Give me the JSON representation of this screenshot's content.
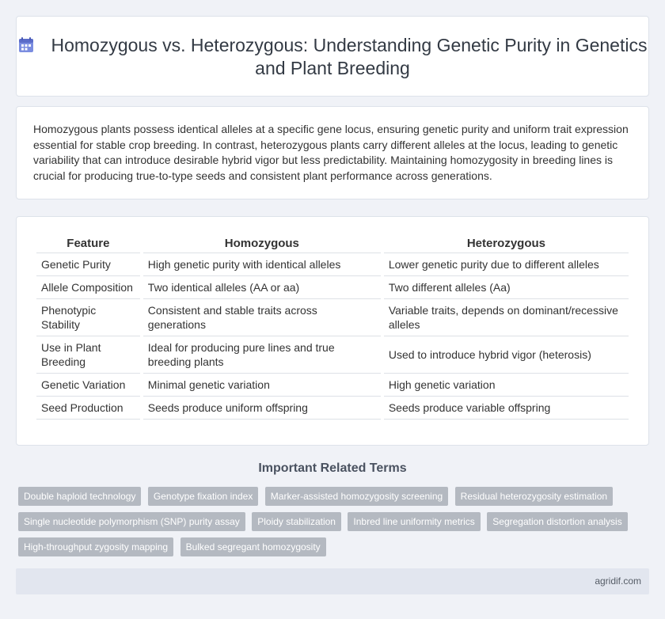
{
  "header": {
    "title": "Homozygous vs. Heterozygous: Understanding Genetic Purity in Genetics and Plant Breeding",
    "icon": "calendar-icon"
  },
  "intro": {
    "text": "Homozygous plants possess identical alleles at a specific gene locus, ensuring genetic purity and uniform trait expression essential for stable crop breeding. In contrast, heterozygous plants carry different alleles at the locus, leading to genetic variability that can introduce desirable hybrid vigor but less predictability. Maintaining homozygosity in breeding lines is crucial for producing true-to-type seeds and consistent plant performance across generations."
  },
  "table": {
    "headers": [
      "Feature",
      "Homozygous",
      "Heterozygous"
    ],
    "rows": [
      [
        "Genetic Purity",
        "High genetic purity with identical alleles",
        "Lower genetic purity due to different alleles"
      ],
      [
        "Allele Composition",
        "Two identical alleles (AA or aa)",
        "Two different alleles (Aa)"
      ],
      [
        "Phenotypic Stability",
        "Consistent and stable traits across generations",
        "Variable traits, depends on dominant/recessive alleles"
      ],
      [
        "Use in Plant Breeding",
        "Ideal for producing pure lines and true breeding plants",
        "Used to introduce hybrid vigor (heterosis)"
      ],
      [
        "Genetic Variation",
        "Minimal genetic variation",
        "High genetic variation"
      ],
      [
        "Seed Production",
        "Seeds produce uniform offspring",
        "Seeds produce variable offspring"
      ]
    ]
  },
  "related": {
    "title": "Important Related Terms",
    "tags": [
      "Double haploid technology",
      "Genotype fixation index",
      "Marker-assisted homozygosity screening",
      "Residual heterozygosity estimation",
      "Single nucleotide polymorphism (SNP) purity assay",
      "Ploidy stabilization",
      "Inbred line uniformity metrics",
      "Segregation distortion analysis",
      "High-throughput zygosity mapping",
      "Bulked segregant homozygosity"
    ]
  },
  "footer": {
    "site": "agridif.com"
  }
}
